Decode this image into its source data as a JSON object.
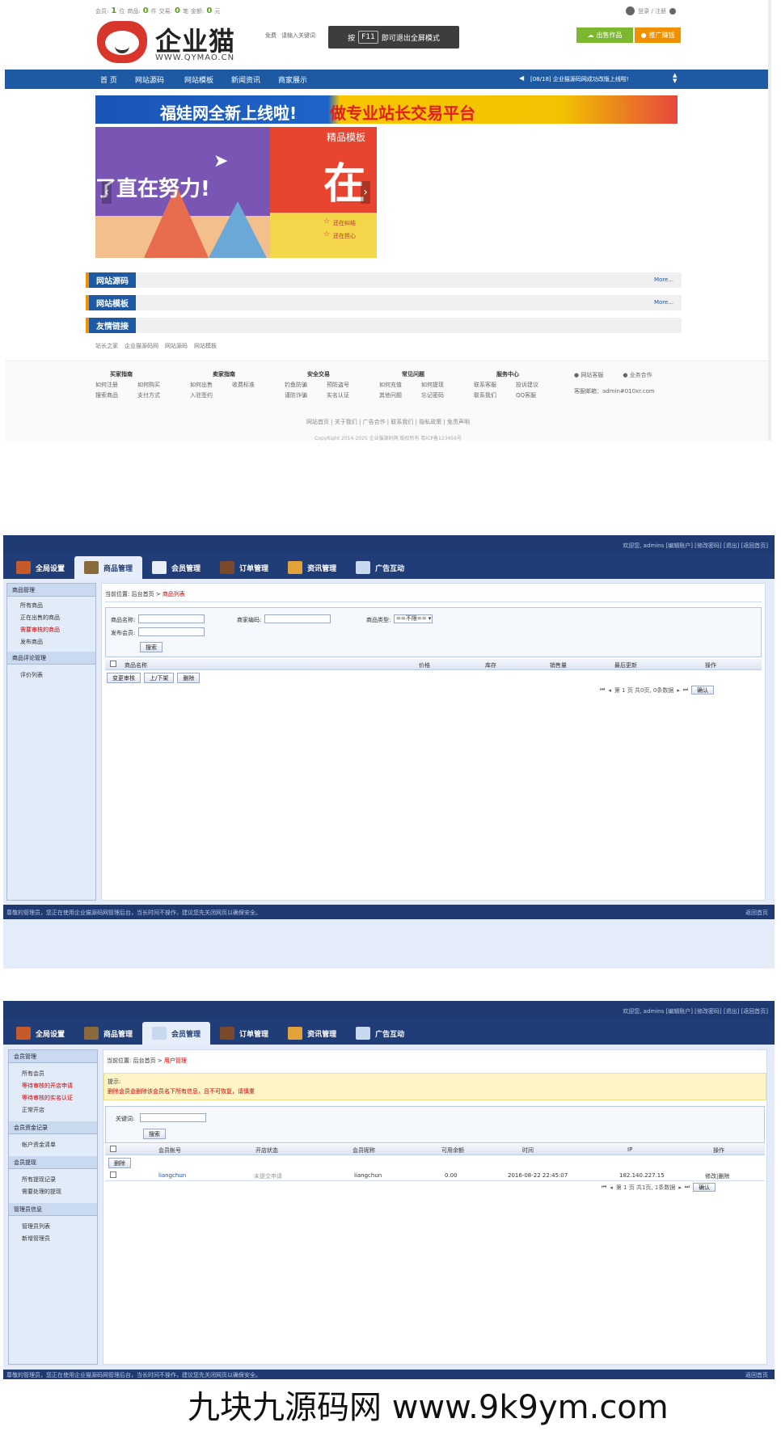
{
  "site": {
    "topbar": {
      "member_label": "会员:",
      "member_count": "1",
      "member_unit": "位",
      "goods_label": "商品:",
      "goods_count": "0",
      "goods_unit": "件",
      "trade_label": "交易:",
      "trade_count": "0",
      "trade_unit": "笔",
      "amount_label": "金额:",
      "amount_count": "0",
      "amount_unit": "元",
      "login": "登录 / 注册"
    },
    "logo_text": "企业猫",
    "logo_url": "WWW.QYMAO.CN",
    "search_scope": "免费",
    "search_placeholder": "请输入关键词",
    "f11_press": "按",
    "f11_key": "F11",
    "f11_text": "即可退出全屏模式",
    "sell_button": "出售作品",
    "promo_button": "推广赚钱",
    "nav": [
      "首 页",
      "网站源码",
      "网站模板",
      "新闻资讯",
      "商家展示"
    ],
    "notice": "[08/18] 企业猫源码网成功改版上线啦!",
    "banner_left": "福娃网全新上线啦!",
    "banner_right": "做专业站长交易平台",
    "slide1_text": "了直在努力!",
    "slide2_tag": "精品模板",
    "slide2_big": "在",
    "slide2_line1": "还在纠结",
    "slide2_line2": "还在担心",
    "sections": [
      "网站源码",
      "网站模板",
      "友情链接"
    ],
    "more": "More...",
    "friend_links": [
      "站长之家",
      "企业猫源码网",
      "网站源码",
      "网站模板"
    ],
    "footer_cols": [
      {
        "title": "买家指南",
        "items": [
          "如何注册",
          "如何购买",
          "搜索商品",
          "支付方式"
        ]
      },
      {
        "title": "卖家指南",
        "items": [
          "如何出售",
          "收费标准",
          "入驻签约",
          ""
        ]
      },
      {
        "title": "安全交易",
        "items": [
          "钓鱼防骗",
          "预防盗号",
          "谨防诈骗",
          "实名认证"
        ]
      },
      {
        "title": "常见问题",
        "items": [
          "如何充值",
          "如何提现",
          "其他问题",
          "忘记密码"
        ]
      },
      {
        "title": "服务中心",
        "items": [
          "联系客服",
          "投诉建议",
          "联系我们",
          "QQ客服"
        ]
      }
    ],
    "contact_a": "网站客服",
    "contact_b": "业务合作",
    "contact_email": "客服邮箱：admin#010xr.com",
    "footer_links": "网站首页 | 关于我们 | 广告合作 | 联系我们 | 隐私政策 | 免责声明",
    "copyright": "CopyRight 2014-2025 企业猫源码网 版权所有 粤ICP备123456号"
  },
  "admin_common": {
    "top_right": "欢迎您, admins [编辑账户] [修改密码] [退出] [返回首页]",
    "tabs": [
      "全局设置",
      "商品管理",
      "会员管理",
      "订单管理",
      "资讯管理",
      "广告互动"
    ],
    "status_left": "尊敬的管理员，您正在使用企业猫源码网管理后台，当长时间不操作，建议您先关闭网页以确保安全。",
    "status_right": "返回首页"
  },
  "admin1": {
    "sidebar": [
      {
        "group": "商品管理",
        "items": [
          {
            "label": "所有商品",
            "red": false
          },
          {
            "label": "正在出售的商品",
            "red": false
          },
          {
            "label": "需要审核的商品",
            "red": true
          },
          {
            "label": "发布商品",
            "red": false
          }
        ]
      },
      {
        "group": "商品评论管理",
        "items": [
          {
            "label": "评价列表",
            "red": false
          }
        ]
      }
    ],
    "crumb_prefix": "当前位置: 后台首页 >",
    "crumb_current": "商品列表",
    "f_name": "商品名称:",
    "f_code": "商家编码:",
    "f_type": "商品类型:",
    "f_type_value": "==不限==",
    "f_member": "发布会员:",
    "search": "搜索",
    "columns": [
      "商品名称",
      "价格",
      "库存",
      "销售量",
      "最后更新",
      "操作"
    ],
    "actions": [
      "变更审核",
      "上/下架",
      "删除"
    ],
    "pager": "第 1 页  共0页, 0条数据",
    "go": "确认"
  },
  "admin2": {
    "sidebar": [
      {
        "group": "会员管理",
        "items": [
          {
            "label": "所有会员",
            "red": false
          },
          {
            "label": "等待审核的开店申请",
            "red": true
          },
          {
            "label": "等待审核的实名认证",
            "red": true
          },
          {
            "label": "正常开店",
            "red": false
          }
        ]
      },
      {
        "group": "会员资金记录",
        "items": [
          {
            "label": "帐户资金清单",
            "red": false
          }
        ]
      },
      {
        "group": "会员提现",
        "items": [
          {
            "label": "所有提现记录",
            "red": false
          },
          {
            "label": "需要处理的提现",
            "red": false
          }
        ]
      },
      {
        "group": "管理员信息",
        "items": [
          {
            "label": "管理员列表",
            "red": false
          },
          {
            "label": "新增管理员",
            "red": false
          }
        ]
      }
    ],
    "crumb_prefix": "当前位置: 后台首页 >",
    "crumb_current": "用户管理",
    "tip_title": "提示:",
    "tip_text": "删除会员会删除该会员名下所有信息，且不可恢复，请慎重",
    "keyword": "关键词:",
    "search": "搜索",
    "columns": [
      "会员帐号",
      "开店状态",
      "会员昵称",
      "可用余额",
      "时间",
      "IP",
      "操作"
    ],
    "delete": "删除",
    "row": [
      "liangchun",
      "未提交申请",
      "liangchun",
      "0.00",
      "2016-08-22 22:45:07",
      "182.140.227.15",
      "修改|删除"
    ],
    "pager": "第 1 页  共1页, 1条数据",
    "go": "确认"
  },
  "watermark": "九块九源码网 www.9k9ym.com"
}
